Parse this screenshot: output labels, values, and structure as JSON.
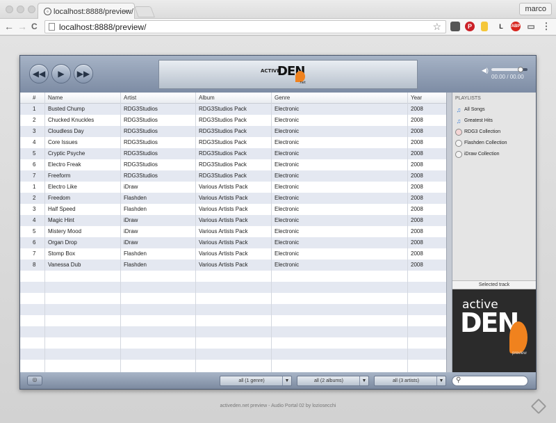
{
  "browser": {
    "tab_title": "localhost:8888/preview/",
    "tab_close": "×",
    "profile": "marco",
    "url": "localhost:8888/preview/",
    "nav": {
      "back": "←",
      "forward": "→",
      "reload": "C"
    },
    "extensions": [
      {
        "name": "pocket-icon",
        "glyph": "",
        "color": "#555555"
      },
      {
        "name": "pinterest-icon",
        "glyph": "P",
        "color": "#cb2027"
      },
      {
        "name": "sticky-icon",
        "glyph": "",
        "color": "#f5c73a"
      },
      {
        "name": "l-extension-icon",
        "glyph": "L",
        "color": "#222222"
      },
      {
        "name": "adblock-icon",
        "glyph": "ABP",
        "color": "#d7261e"
      },
      {
        "name": "cast-icon",
        "glyph": "▭",
        "color": "#666666"
      },
      {
        "name": "menu-icon",
        "glyph": "⋮",
        "color": "#666666"
      }
    ]
  },
  "player": {
    "controls": {
      "rewind": "◀◀",
      "play": "▶",
      "forward": "▶▶"
    },
    "logo": {
      "small": "ACTIVE",
      "big": "DEN",
      "suffix": ".net"
    },
    "volume_level": 0.8,
    "time": "00.00 / 00.00",
    "columns": [
      "#",
      "Name",
      "Artist",
      "Album",
      "Genre",
      "Year"
    ],
    "tracks": [
      [
        "1",
        "Busted Chump",
        "RDG3Studios",
        "RDG3Studios Pack",
        "Electronic",
        "2008"
      ],
      [
        "2",
        "Chucked Knuckles",
        "RDG3Studios",
        "RDG3Studios Pack",
        "Electronic",
        "2008"
      ],
      [
        "3",
        "Cloudless Day",
        "RDG3Studios",
        "RDG3Studios Pack",
        "Electronic",
        "2008"
      ],
      [
        "4",
        "Core Issues",
        "RDG3Studios",
        "RDG3Studios Pack",
        "Electronic",
        "2008"
      ],
      [
        "5",
        "Cryptic Psyche",
        "RDG3Studios",
        "RDG3Studios Pack",
        "Electronic",
        "2008"
      ],
      [
        "6",
        "Electro Freak",
        "RDG3Studios",
        "RDG3Studios Pack",
        "Electronic",
        "2008"
      ],
      [
        "7",
        "Freeform",
        "RDG3Studios",
        "RDG3Studios Pack",
        "Electronic",
        "2008"
      ],
      [
        "1",
        "Electro Like",
        "iDraw",
        "Various Artists Pack",
        "Electronic",
        "2008"
      ],
      [
        "2",
        "Freedom",
        "Flashden",
        "Various Artists Pack",
        "Electronic",
        "2008"
      ],
      [
        "3",
        "Half Speed",
        "Flashden",
        "Various Artists Pack",
        "Electronic",
        "2008"
      ],
      [
        "4",
        "Magic Hint",
        "iDraw",
        "Various Artists Pack",
        "Electronic",
        "2008"
      ],
      [
        "5",
        "Mistery Mood",
        "iDraw",
        "Various Artists Pack",
        "Electronic",
        "2008"
      ],
      [
        "6",
        "Organ Drop",
        "iDraw",
        "Various Artists Pack",
        "Electronic",
        "2008"
      ],
      [
        "7",
        "Stomp Box",
        "Flashden",
        "Various Artists Pack",
        "Electronic",
        "2008"
      ],
      [
        "8",
        "Vanessa Dub",
        "Flashden",
        "Various Artists Pack",
        "Electronic",
        "2008"
      ]
    ],
    "sidebar": {
      "title": "PLAYLISTS",
      "items": [
        {
          "label": "All Songs",
          "icon": "music-note-icon"
        },
        {
          "label": "Greatest Hits",
          "icon": "music-note-icon"
        },
        {
          "label": "RDG3 Collection",
          "icon": "record-icon"
        },
        {
          "label": "Flashden Collection",
          "icon": "record-icon"
        },
        {
          "label": "iDraw Collection",
          "icon": "record-icon"
        }
      ],
      "selected_title": "Selected track",
      "art": {
        "line1": "active",
        "line2": "DEN",
        "line3": "preview"
      }
    },
    "bottom": {
      "genre": "all (1 genre)",
      "albums": "all (2 albums)",
      "artists": "all (3 artists)",
      "search_placeholder": ""
    }
  },
  "footer": "activeden.net preview - Audio Portal 02 by loziosecchi"
}
